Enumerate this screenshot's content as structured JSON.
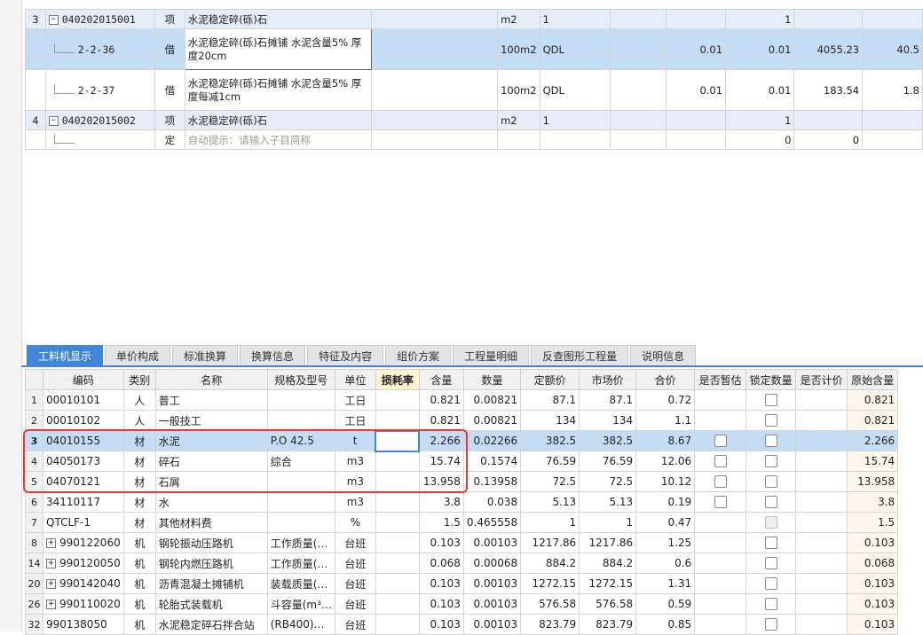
{
  "top_rows": [
    {
      "row": "3",
      "code": "040202015001",
      "type": "项",
      "name": "水泥稳定碎(砾)石",
      "unit": "m2",
      "qty_expr": "1",
      "v1": "",
      "v2": "1",
      "price": "",
      "total": "",
      "kind": "level",
      "expand": "−"
    },
    {
      "row": "",
      "code": "2-2-36",
      "type": "借",
      "name": "水泥稳定碎(砾)石摊铺 水泥含量5% 厚度20cm",
      "unit": "100m2",
      "qty_expr": "QDL",
      "v1": "0.01",
      "v2": "0.01",
      "price": "4055.23",
      "total": "40.5",
      "kind": "selected"
    },
    {
      "row": "",
      "code": "2-2-37",
      "type": "借",
      "name": "水泥稳定碎(砾)石摊铺 水泥含量5% 厚度每减1cm",
      "unit": "100m2",
      "qty_expr": "QDL",
      "v1": "0.01",
      "v2": "0.01",
      "price": "183.54",
      "total": "1.8",
      "kind": "child"
    },
    {
      "row": "4",
      "code": "040202015002",
      "type": "项",
      "name": "水泥稳定碎(砾)石",
      "unit": "m2",
      "qty_expr": "1",
      "v1": "",
      "v2": "1",
      "price": "",
      "total": "",
      "kind": "level",
      "expand": "−"
    },
    {
      "row": "",
      "code": "",
      "type": "定",
      "name": "自动提示：请输入子目简称",
      "unit": "",
      "qty_expr": "",
      "v1": "",
      "v2": "0",
      "price": "0",
      "total": "",
      "kind": "hint"
    }
  ],
  "tabs": [
    "工料机显示",
    "单价构成",
    "标准换算",
    "换算信息",
    "特征及内容",
    "组价方案",
    "工程量明细",
    "反查图形工程量",
    "说明信息"
  ],
  "columns": [
    "编码",
    "类别",
    "名称",
    "规格及型号",
    "单位",
    "损耗率",
    "含量",
    "数量",
    "定额价",
    "市场价",
    "合价",
    "是否暂估",
    "锁定数量",
    "是否计价",
    "原始含量"
  ],
  "rows": [
    {
      "rn": "1",
      "expand": "",
      "code": "00010101",
      "cat": "人",
      "name": "普工",
      "spec": "",
      "unit": "工日",
      "loss": "",
      "content": "0.821",
      "qty": "0.00821",
      "quota": "87.1",
      "market": "87.1",
      "total": "0.72",
      "est": false,
      "lock": true,
      "lock_dis": false,
      "priced": false,
      "orig": "0.821"
    },
    {
      "rn": "2",
      "expand": "",
      "code": "00010102",
      "cat": "人",
      "name": "一般技工",
      "spec": "",
      "unit": "工日",
      "loss": "",
      "content": "0.821",
      "qty": "0.00821",
      "quota": "134",
      "market": "134",
      "total": "1.1",
      "est": false,
      "lock": true,
      "lock_dis": false,
      "priced": false,
      "orig": "0.821"
    },
    {
      "rn": "3",
      "expand": "",
      "code": "04010155",
      "cat": "材",
      "name": "水泥",
      "spec": "P.O 42.5",
      "unit": "t",
      "loss": "",
      "content": "2.266",
      "qty": "0.02266",
      "quota": "382.5",
      "market": "382.5",
      "total": "8.67",
      "est": true,
      "lock": true,
      "lock_dis": false,
      "priced": false,
      "orig": "2.266",
      "selected": true
    },
    {
      "rn": "4",
      "expand": "",
      "code": "04050173",
      "cat": "材",
      "name": "碎石",
      "spec": "综合",
      "unit": "m3",
      "loss": "",
      "content": "15.74",
      "qty": "0.1574",
      "quota": "76.59",
      "market": "76.59",
      "total": "12.06",
      "est": true,
      "lock": true,
      "lock_dis": false,
      "priced": false,
      "orig": "15.74"
    },
    {
      "rn": "5",
      "expand": "",
      "code": "04070121",
      "cat": "材",
      "name": "石屑",
      "spec": "",
      "unit": "m3",
      "loss": "",
      "content": "13.958",
      "qty": "0.13958",
      "quota": "72.5",
      "market": "72.5",
      "total": "10.12",
      "est": true,
      "lock": true,
      "lock_dis": false,
      "priced": false,
      "orig": "13.958"
    },
    {
      "rn": "6",
      "expand": "",
      "code": "34110117",
      "cat": "材",
      "name": "水",
      "spec": "",
      "unit": "m3",
      "loss": "",
      "content": "3.8",
      "qty": "0.038",
      "quota": "5.13",
      "market": "5.13",
      "total": "0.19",
      "est": true,
      "lock": true,
      "lock_dis": false,
      "priced": false,
      "orig": "3.8"
    },
    {
      "rn": "7",
      "expand": "",
      "code": "QTCLF-1",
      "cat": "材",
      "name": "其他材料费",
      "spec": "",
      "unit": "%",
      "loss": "",
      "content": "1.5",
      "qty": "0.465558",
      "quota": "1",
      "market": "1",
      "total": "0.47",
      "est": false,
      "lock": true,
      "lock_dis": true,
      "priced": false,
      "orig": "1.5"
    },
    {
      "rn": "8",
      "expand": "+",
      "code": "990122060",
      "cat": "机",
      "name": "钢轮振动压路机",
      "spec": "工作质量(…",
      "unit": "台班",
      "loss": "",
      "content": "0.103",
      "qty": "0.00103",
      "quota": "1217.86",
      "market": "1217.86",
      "total": "1.25",
      "est": false,
      "lock": true,
      "lock_dis": false,
      "priced": false,
      "orig": "0.103"
    },
    {
      "rn": "14",
      "expand": "+",
      "code": "990120050",
      "cat": "机",
      "name": "钢轮内燃压路机",
      "spec": "工作质量(…",
      "unit": "台班",
      "loss": "",
      "content": "0.068",
      "qty": "0.00068",
      "quota": "884.2",
      "market": "884.2",
      "total": "0.6",
      "est": false,
      "lock": true,
      "lock_dis": false,
      "priced": false,
      "orig": "0.068"
    },
    {
      "rn": "20",
      "expand": "+",
      "code": "990142040",
      "cat": "机",
      "name": "沥青混凝土摊铺机",
      "spec": "装载质量(…",
      "unit": "台班",
      "loss": "",
      "content": "0.103",
      "qty": "0.00103",
      "quota": "1272.15",
      "market": "1272.15",
      "total": "1.31",
      "est": false,
      "lock": true,
      "lock_dis": false,
      "priced": false,
      "orig": "0.103"
    },
    {
      "rn": "26",
      "expand": "+",
      "code": "990110020",
      "cat": "机",
      "name": "轮胎式装载机",
      "spec": "斗容量(m³…",
      "unit": "台班",
      "loss": "",
      "content": "0.103",
      "qty": "0.00103",
      "quota": "576.58",
      "market": "576.58",
      "total": "0.59",
      "est": false,
      "lock": true,
      "lock_dis": false,
      "priced": false,
      "orig": "0.103"
    },
    {
      "rn": "32",
      "expand": "",
      "code": "990138050",
      "cat": "机",
      "name": "水泥稳定碎石拌合站",
      "spec": "(RB400)…",
      "unit": "台班",
      "loss": "",
      "content": "0.103",
      "qty": "0.00103",
      "quota": "823.79",
      "market": "823.79",
      "total": "0.85",
      "est": false,
      "lock": true,
      "lock_dis": false,
      "priced": false,
      "orig": "0.103"
    }
  ]
}
